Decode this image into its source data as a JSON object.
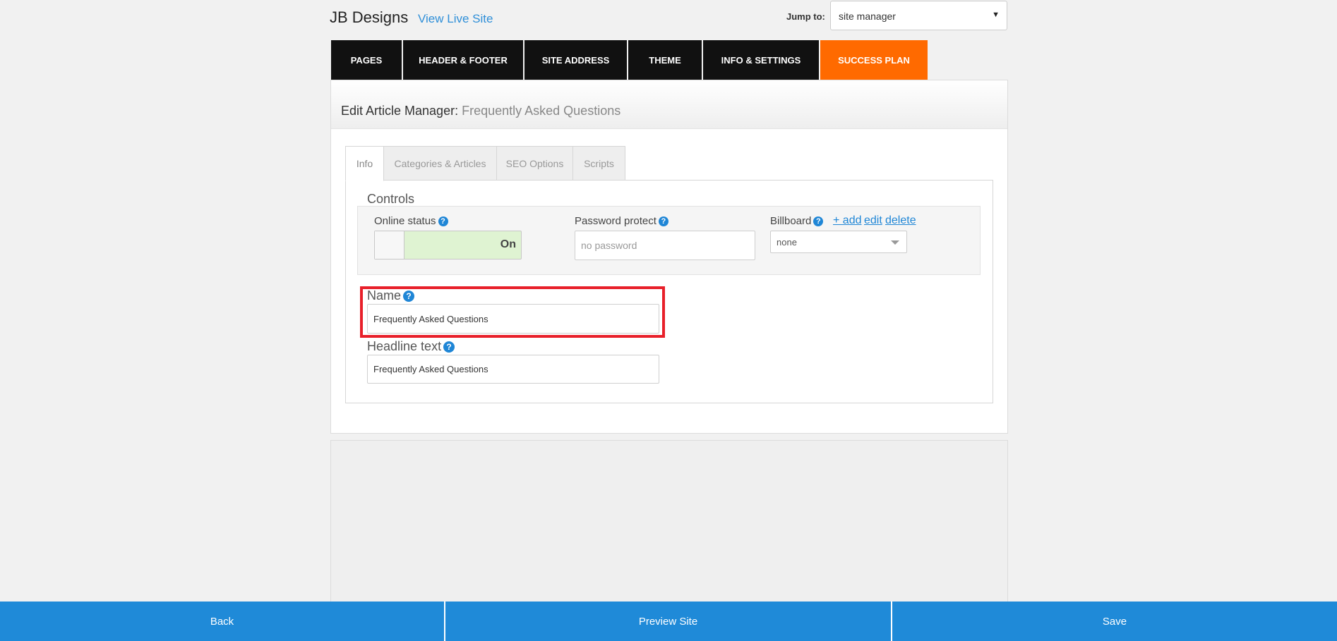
{
  "header": {
    "brand": "JB Designs",
    "live_link": "View Live Site",
    "jump_label": "Jump to:",
    "jump_value": "site manager"
  },
  "nav": {
    "tabs": [
      {
        "label": "PAGES"
      },
      {
        "label": "HEADER & FOOTER"
      },
      {
        "label": "SITE ADDRESS"
      },
      {
        "label": "THEME"
      },
      {
        "label": "INFO & SETTINGS"
      },
      {
        "label": "SUCCESS PLAN"
      }
    ],
    "accent_color": "#ff6a00"
  },
  "panel": {
    "title": "Edit Article Manager:",
    "subtitle": "Frequently Asked Questions"
  },
  "inner_tabs": [
    {
      "label": "Info"
    },
    {
      "label": "Categories & Articles"
    },
    {
      "label": "SEO Options"
    },
    {
      "label": "Scripts"
    }
  ],
  "controls": {
    "heading": "Controls",
    "online_status_label": "Online status",
    "online_status_value": "On",
    "password_label": "Password protect",
    "password_placeholder": "no password",
    "billboard_label": "Billboard",
    "billboard_add": "+ add",
    "billboard_edit": "edit",
    "billboard_delete": "delete",
    "billboard_value": "none"
  },
  "fields": {
    "name_label": "Name",
    "name_value": "Frequently Asked Questions",
    "headline_label": "Headline text",
    "headline_value": "Frequently Asked Questions"
  },
  "footer": {
    "back": "Back",
    "preview": "Preview Site",
    "save": "Save"
  },
  "help_icon_glyph": "?"
}
